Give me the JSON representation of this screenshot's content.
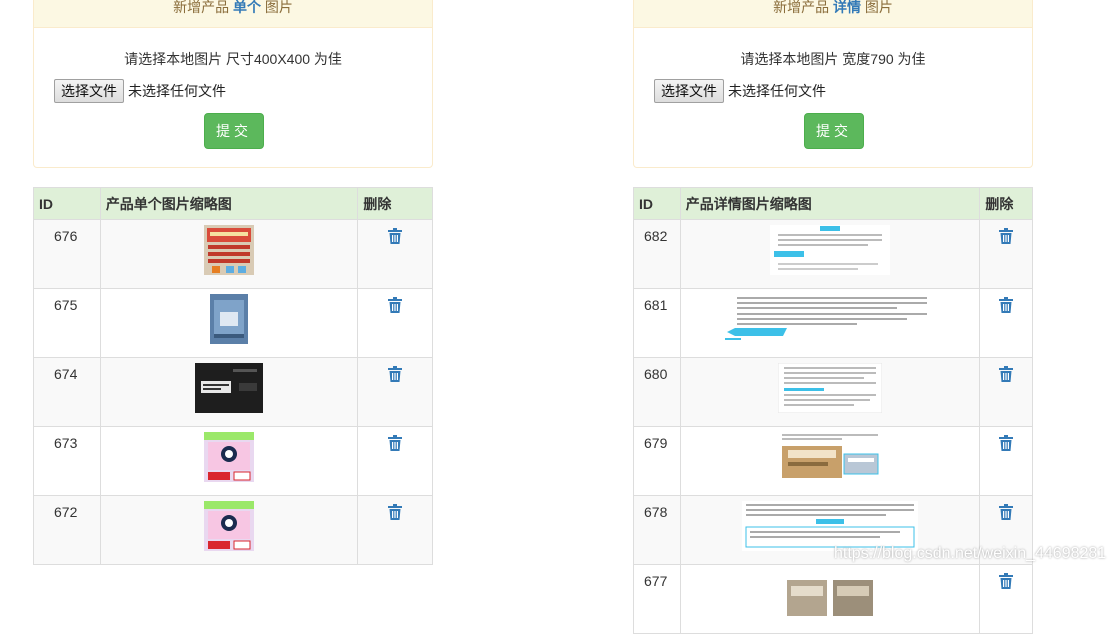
{
  "left_panel": {
    "title_prefix": "新增产品",
    "title_highlight": "单个",
    "title_suffix": "图片",
    "hint": "请选择本地图片 尺寸400X400 为佳",
    "file_button": "选择文件",
    "file_status": "未选择任何文件",
    "submit": "提交"
  },
  "right_panel": {
    "title_prefix": "新增产品",
    "title_highlight": "详情",
    "title_suffix": "图片",
    "hint": "请选择本地图片 宽度790 为佳",
    "file_button": "选择文件",
    "file_status": "未选择任何文件",
    "submit": "提交"
  },
  "left_table": {
    "headers": [
      "ID",
      "产品单个图片缩略图",
      "删除"
    ],
    "rows": [
      {
        "id": "676"
      },
      {
        "id": "675"
      },
      {
        "id": "674"
      },
      {
        "id": "673"
      },
      {
        "id": "672"
      }
    ]
  },
  "right_table": {
    "headers": [
      "ID",
      "产品详情图片缩略图",
      "删除"
    ],
    "rows": [
      {
        "id": "682"
      },
      {
        "id": "681"
      },
      {
        "id": "680"
      },
      {
        "id": "679"
      },
      {
        "id": "678"
      },
      {
        "id": "677"
      }
    ]
  },
  "watermark": "https://blog.csdn.net/weixin_44698281",
  "colors": {
    "panel_header_bg": "#fcf8e3",
    "panel_border": "#faebcc",
    "highlight": "#337ab7",
    "submit_green": "#5cb85c",
    "table_header_bg": "#dff0d8",
    "trash_blue": "#337ab7"
  },
  "icons": {
    "delete": "trash-icon"
  }
}
